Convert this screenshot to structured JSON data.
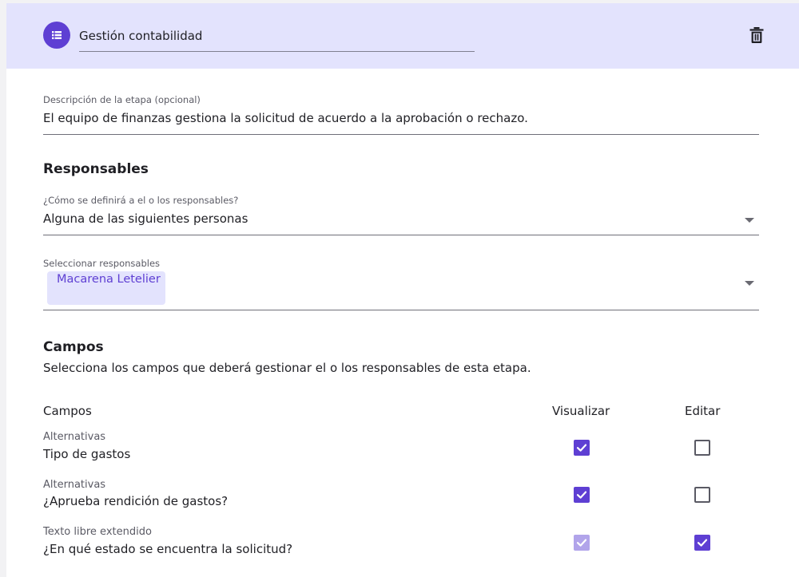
{
  "stage": {
    "icon": "list-icon",
    "title": "Gestión contabilidad",
    "delete_icon": "trash-icon"
  },
  "description": {
    "label": "Descripción de la etapa (opcional)",
    "value": "El equipo de finanzas gestiona la solicitud de acuerdo a la aprobación o rechazo."
  },
  "responsables": {
    "title": "Responsables",
    "mode_label": "¿Cómo se definirá a el o los responsables?",
    "mode_value": "Alguna de las siguientes personas",
    "select_label": "Seleccionar responsables",
    "selected": [
      "Macarena Letelier"
    ]
  },
  "campos": {
    "title": "Campos",
    "description": "Selecciona los campos que deberá gestionar el o los responsables de esta etapa.",
    "columns": {
      "field": "Campos",
      "view": "Visualizar",
      "edit": "Editar"
    },
    "rows": [
      {
        "type": "Alternativas",
        "name": "Tipo de gastos",
        "view": true,
        "view_disabled": false,
        "edit": false
      },
      {
        "type": "Alternativas",
        "name": "¿Aprueba rendición de gastos?",
        "view": true,
        "view_disabled": false,
        "edit": false
      },
      {
        "type": "Texto libre extendido",
        "name": "¿En qué estado se encuentra la solicitud?",
        "view": true,
        "view_disabled": true,
        "edit": true
      }
    ]
  },
  "colors": {
    "accent": "#5e3fd3",
    "header_bg": "#e3e3fd",
    "chip_bg": "#e3e3fd",
    "disabled_check": "#b1a4ea"
  }
}
